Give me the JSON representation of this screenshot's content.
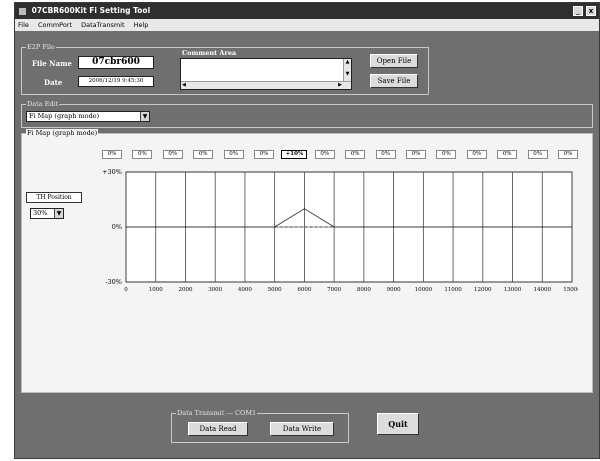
{
  "window": {
    "title": "07CBR600Kit Fi Setting Tool",
    "min_btn": "_",
    "close_btn": "x"
  },
  "menu": [
    "File",
    "CommPort",
    "DataTransmit",
    "Help"
  ],
  "ecu_file": {
    "group_label": "E2P File",
    "file_name_label": "File Name",
    "file_name_value": "07cbr600",
    "date_label": "Date",
    "date_value": "2006/12/19 9:45:30"
  },
  "comment": {
    "label": "Comment Area",
    "value": ""
  },
  "file_buttons": {
    "open": "Open File",
    "save": "Save File"
  },
  "data_edit": {
    "group_label": "Data Edit",
    "selected": "Fi Map (graph mode)"
  },
  "map_panel": {
    "label": "Fi Map (graph mode)",
    "th_position_label": "TH Position",
    "th_position_value": "30%",
    "percent_cells": [
      "0%",
      "0%",
      "0%",
      "0%",
      "0%",
      "0%",
      "+10%",
      "0%",
      "0%",
      "0%",
      "0%",
      "0%",
      "0%",
      "0%",
      "0%",
      "0%"
    ],
    "active_cell_index": 6
  },
  "chart_data": {
    "type": "line",
    "x": [
      0,
      1000,
      2000,
      3000,
      4000,
      5000,
      6000,
      7000,
      8000,
      9000,
      10000,
      11000,
      12000,
      13000,
      14000,
      15000
    ],
    "x_tick_labels": [
      "0",
      "1000",
      "2000",
      "3000",
      "4000",
      "5000",
      "6000",
      "7000",
      "8000",
      "9000",
      "10000",
      "11000",
      "12000",
      "13000",
      "14000",
      "15000"
    ],
    "y_tick_labels": [
      "+30%",
      "0%",
      "-30%"
    ],
    "ylim": [
      -30,
      30
    ],
    "series": [
      {
        "values": [
          0,
          0,
          0,
          0,
          0,
          0,
          10,
          0,
          0,
          0,
          0,
          0,
          0,
          0,
          0,
          0
        ]
      }
    ],
    "grid": true
  },
  "transmit": {
    "group_label": "Data Transmit --- COM1",
    "read_button": "Data Read",
    "write_button": "Data Write"
  },
  "quit_button": "Quit",
  "colors": {
    "window_bg": "#6f6f6f",
    "panel_bg": "#f4f4f4",
    "titlebar": "#2f2f2f"
  }
}
